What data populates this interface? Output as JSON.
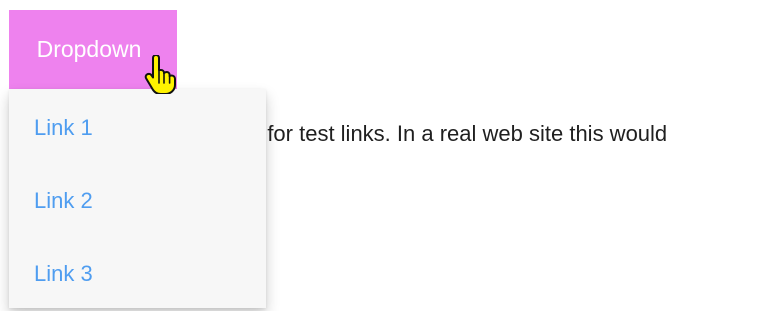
{
  "dropdown": {
    "button_label": "Dropdown",
    "background_color": "#ee82ee",
    "text_color": "#ffffff",
    "menu_background": "#f7f7f7",
    "link_color": "#4f9df0",
    "items": [
      {
        "label": "Link 1"
      },
      {
        "label": "Link 2"
      },
      {
        "label": "Link 3"
      }
    ]
  },
  "content": {
    "visible_text": "' for test links. In a real web site this would"
  },
  "cursor": {
    "icon": "hand-pointer-cursor-icon",
    "fill_color": "#fff200"
  }
}
